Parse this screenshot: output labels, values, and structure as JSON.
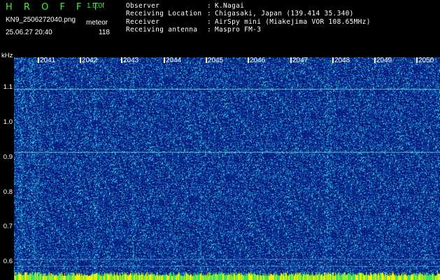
{
  "header": {
    "brand": "H R O F F T",
    "version": "1.0.0f",
    "filename": "KN9_2506272040.png",
    "timestamp": "25.06.27 20:40",
    "meteor_label": "meteor",
    "meteor_count": "118",
    "info": [
      {
        "label": "Observer",
        "sep": ":",
        "value": "K.Nagai"
      },
      {
        "label": "Receiving Location",
        "sep": ":",
        "value": "Chigasaki, Japan (139.414 35.340)"
      },
      {
        "label": "Receiver",
        "sep": ":",
        "value": "AirSpy mini (Miakejima VOR 108.65MHz)"
      },
      {
        "label": "Receiving antenna",
        "sep": ":",
        "value": "Maspro FM-3"
      }
    ]
  },
  "axis": {
    "y_unit": "kHz",
    "time_ticks": [
      "2041",
      "2042",
      "2043",
      "2044",
      "2045",
      "2046",
      "2047",
      "2048",
      "2049",
      "2050"
    ],
    "freq_ticks": [
      "1.1",
      "1.0",
      "0.9",
      "0.8",
      "0.7",
      "0.6"
    ]
  },
  "colors": {
    "brand_green": "#3cf03c",
    "background": "#000000",
    "waterfall_base": "#061876",
    "baseline_yellow": "#f0f000"
  }
}
